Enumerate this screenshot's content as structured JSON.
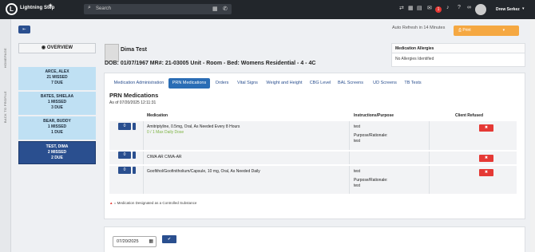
{
  "app": {
    "brand": "Lightning Step",
    "logo_glyph": "L"
  },
  "topbar": {
    "search_placeholder": "Search",
    "badge_count": "1",
    "user_name": "Drew Serkez"
  },
  "side": {
    "homepage_label": "HOMEPAGE",
    "back_label": "BACK TO PROFILE"
  },
  "overview": {
    "label": "OVERVIEW"
  },
  "patients": [
    {
      "name": "ARCE, ALEX",
      "missed": "21 MISSED",
      "due": "7 DUE"
    },
    {
      "name": "BATES, SHIELAA",
      "missed": "1 MISSED",
      "due": "3 DUE"
    },
    {
      "name": "BEAR, BUDDY",
      "missed": "1 MISSED",
      "due": "1 DUE"
    },
    {
      "name": "TEST, DIMA",
      "missed": "2 MISSED",
      "due": "2 DUE"
    }
  ],
  "header": {
    "auto_refresh": "Auto Refresh in 14 Minutes",
    "print_label": "Print"
  },
  "patient": {
    "name": "Dima Test",
    "info": "DOB: 01/07/1967   MR#: 21-03005   Unit - Room - Bed: Womens Residential - 4 - 4C"
  },
  "allergies": {
    "title": "Medication Allergies",
    "value": "No Allergies Identified"
  },
  "tabs": [
    "Medication Administration",
    "PRN Medications",
    "Orders",
    "Vital Signs",
    "Weight and Height",
    "CBG Level",
    "BAL Screens",
    "UD Screens",
    "TB Tests"
  ],
  "prn": {
    "title": "PRN Medications",
    "as_of": "As of 07/20/2025 12:11:31",
    "headers": [
      "Medication",
      "Instructions/Purpose",
      "Client Refused"
    ],
    "rows": [
      {
        "count": "0",
        "med": "Amitriptyline, 0.5mg, Oral, As Needed Every 8 Hours",
        "sub": "0 / 1 Max Daily Dose",
        "ins1": "test",
        "ins2": "Purpose/Rationale:",
        "ins3": "test"
      },
      {
        "count": "0",
        "med": "CIWA AR CIWA-AR",
        "sub": "",
        "ins1": "",
        "ins2": "",
        "ins3": ""
      },
      {
        "count": "0",
        "med": "Goofithol/Goofinitholium/Capsule, 10 mg, Oral, As Needed Daily",
        "sub": "",
        "ins1": "test",
        "ins2": "Purpose/Rationale:",
        "ins3": "test"
      }
    ],
    "legend": "= Medication Designated as a Controlled Substance"
  },
  "date_filter": {
    "value": "07/20/2025"
  }
}
